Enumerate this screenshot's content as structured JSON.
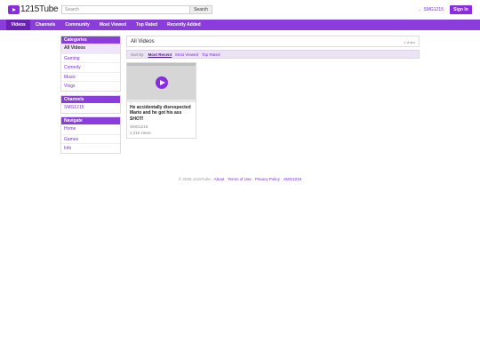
{
  "app": {
    "logo_text": "1215Tube"
  },
  "header": {
    "search_placeholder": "Search",
    "search_button": "Search",
    "user_link": "← SMG1215",
    "signin_button": "Sign In"
  },
  "nav": {
    "items": [
      {
        "label": "Videos",
        "active": true
      },
      {
        "label": "Channels",
        "active": false
      },
      {
        "label": "Community",
        "active": false
      },
      {
        "label": "Most Viewed",
        "active": false
      },
      {
        "label": "Top Rated",
        "active": false
      },
      {
        "label": "Recently Added",
        "active": false
      }
    ]
  },
  "sidebar": {
    "categories": {
      "title": "Categories",
      "items": [
        "All Videos",
        "Gaming",
        "Comedy",
        "Music",
        "Vlogs"
      ]
    },
    "channels": {
      "title": "Channels",
      "items": [
        "SMG1215"
      ]
    },
    "navigate": {
      "title": "Navigate",
      "items": [
        "Home",
        "Games",
        "Info"
      ]
    }
  },
  "main": {
    "title": "All Videos",
    "count": "1 video",
    "sort": {
      "label": "Sort by:",
      "options": [
        "Most Recent",
        "Most Viewed",
        "Top Rated"
      ],
      "active": "Most Recent"
    },
    "videos": [
      {
        "title": "He accidentally disrespected Mario and he got his ass SHOT!",
        "channel": "SMG1215",
        "views": "1,215 views"
      }
    ]
  },
  "footer": {
    "copyright": "© 2025 1215Tube",
    "sep": " · ",
    "links": [
      "About",
      "Terms of Use",
      "Privacy Policy",
      "SMG1215"
    ]
  },
  "colors": {
    "accent": "#8a2be2",
    "nav_bg": "#8a3cdd",
    "nav_active": "#6b21b8",
    "link": "#7b2fd6"
  }
}
